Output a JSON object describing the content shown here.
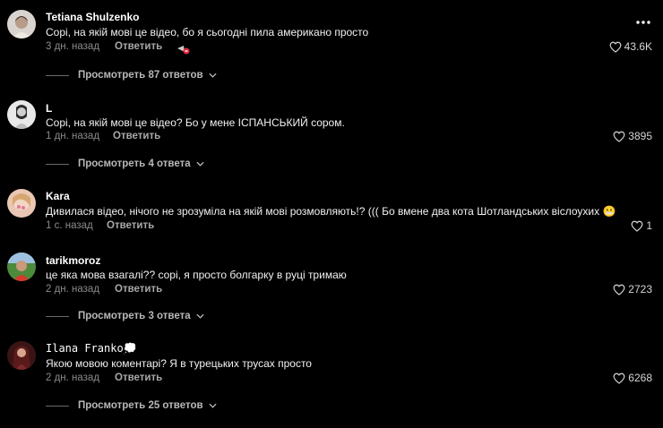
{
  "comments": [
    {
      "username": "Tetiana Shulzenko",
      "text": "Сорі, на якій мові це відео, бо я сьогодні пила американо просто",
      "time": "3 дн. назад",
      "reply_label": "Ответить",
      "likes": "43.6K",
      "view_replies": "Просмотреть 87 ответов"
    },
    {
      "username": "L",
      "text": "Сорі, на якій мові це відео? Бо у мене ІСПАНСЬКИЙ сором.",
      "time": "1 дн. назад",
      "reply_label": "Ответить",
      "likes": "3895",
      "view_replies": "Просмотреть 4 ответа"
    },
    {
      "username": "Kara",
      "text": "Дивилася відео, нічого не зрозуміла на якій мові розмовляють!? ((( Бо вмене два кота Шотландських віслоухих",
      "emoji": "😬",
      "time": "1 с. назад",
      "reply_label": "Ответить",
      "likes": "1"
    },
    {
      "username": "tarikmoroz",
      "text": "це яка мова взагалі?? сорі, я просто болгарку в руці тримаю",
      "time": "2 дн. назад",
      "reply_label": "Ответить",
      "likes": "2723",
      "view_replies": "Просмотреть 3 ответа"
    },
    {
      "username": "𝙸𝚕𝚊𝚗𝚊 𝙵𝚛𝚊𝚗𝚔𝚘",
      "username_emoji": "💭",
      "text": "Якою мовою коментарі? Я в турецьких трусах просто",
      "time": "2 дн. назад",
      "reply_label": "Ответить",
      "likes": "6268",
      "view_replies": "Просмотреть 25 ответов"
    }
  ],
  "icons": {
    "more": "more-horizontal-icon",
    "heart": "heart-outline-icon",
    "chevron": "chevron-down-icon"
  },
  "colors": {
    "background": "#000000",
    "text": "#ffffff",
    "muted": "#8a8a8a"
  }
}
